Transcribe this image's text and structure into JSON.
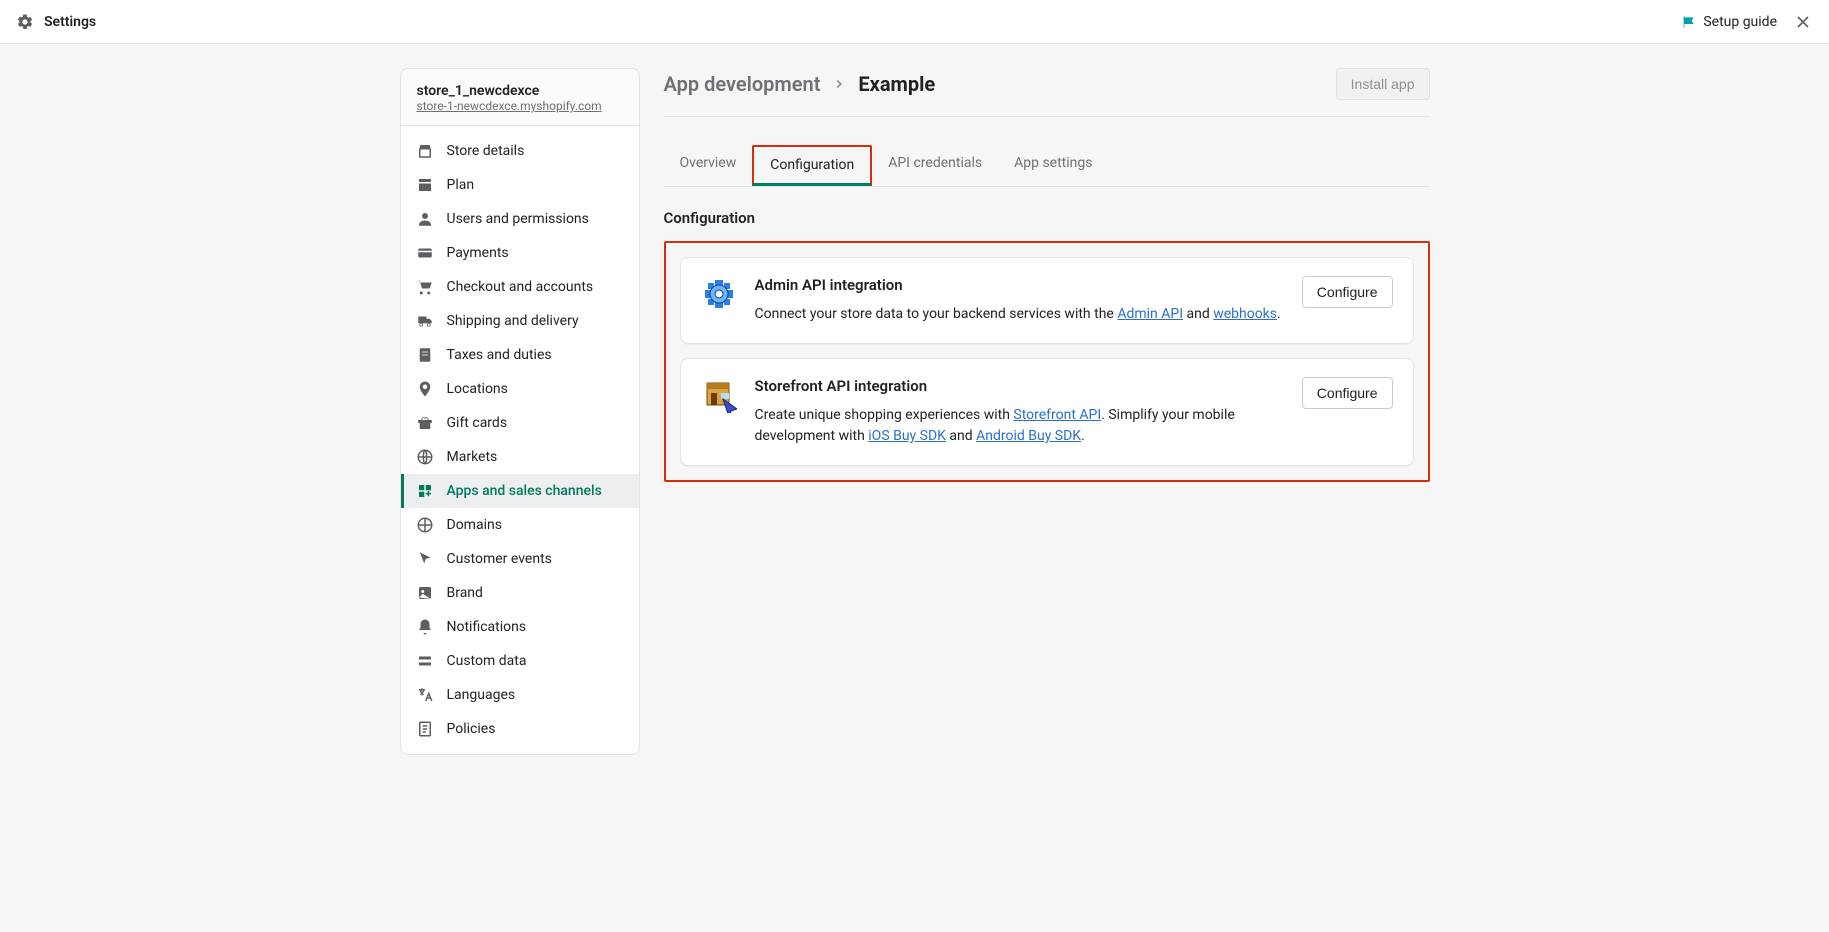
{
  "topbar": {
    "title": "Settings",
    "setup_guide": "Setup guide"
  },
  "store": {
    "name": "store_1_newcdexce",
    "url": "store-1-newcdexce.myshopify.com"
  },
  "nav": {
    "store_details": "Store details",
    "plan": "Plan",
    "users": "Users and permissions",
    "payments": "Payments",
    "checkout": "Checkout and accounts",
    "shipping": "Shipping and delivery",
    "taxes": "Taxes and duties",
    "locations": "Locations",
    "gift_cards": "Gift cards",
    "markets": "Markets",
    "apps": "Apps and sales channels",
    "domains": "Domains",
    "customer_events": "Customer events",
    "brand": "Brand",
    "notifications": "Notifications",
    "custom_data": "Custom data",
    "languages": "Languages",
    "policies": "Policies"
  },
  "breadcrumb": {
    "parent": "App development",
    "current": "Example"
  },
  "actions": {
    "install": "Install app"
  },
  "tabs": {
    "overview": "Overview",
    "configuration": "Configuration",
    "api_credentials": "API credentials",
    "app_settings": "App settings"
  },
  "section": {
    "title": "Configuration"
  },
  "cards": {
    "admin": {
      "title": "Admin API integration",
      "desc_prefix": "Connect your store data to your backend services with the ",
      "link_admin_api": "Admin API",
      "desc_and": " and ",
      "link_webhooks": "webhooks",
      "desc_suffix": ".",
      "button": "Configure"
    },
    "storefront": {
      "title": "Storefront API integration",
      "desc_prefix": "Create unique shopping experiences with ",
      "link_storefront": "Storefront API",
      "desc_mid": ". Simplify your mobile development with ",
      "link_ios": "iOS Buy SDK",
      "desc_and": " and ",
      "link_android": "Android Buy SDK",
      "desc_suffix": ".",
      "button": "Configure"
    }
  }
}
